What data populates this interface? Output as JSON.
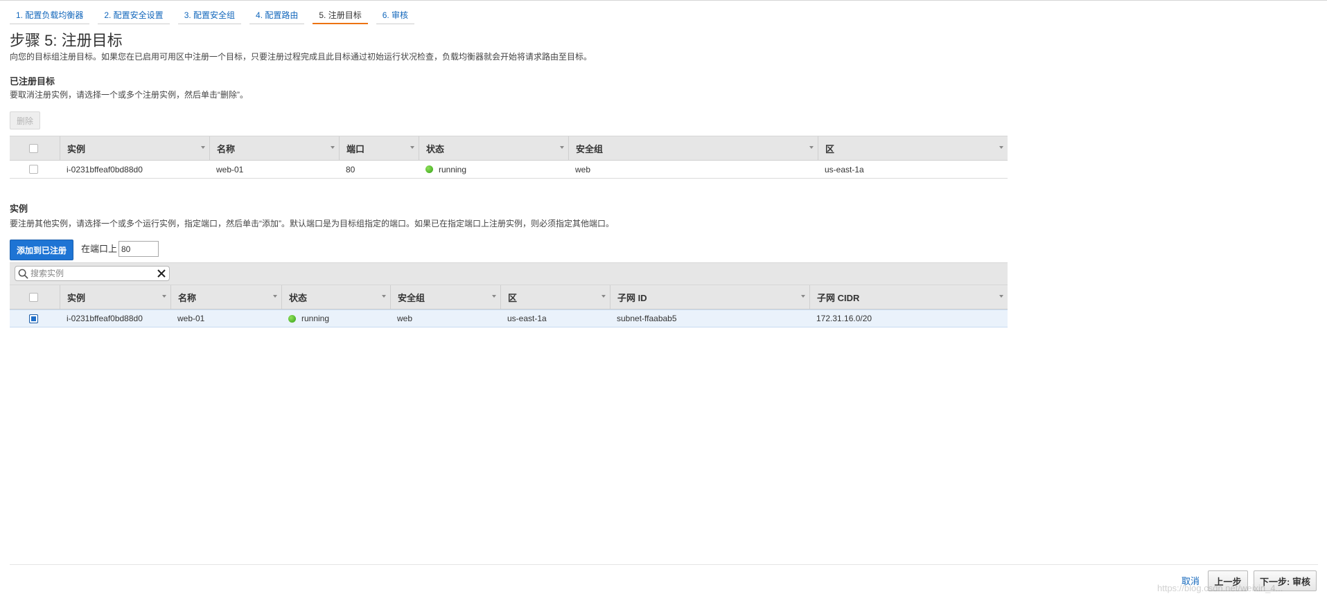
{
  "steps": [
    {
      "label": "1. 配置负载均衡器"
    },
    {
      "label": "2. 配置安全设置"
    },
    {
      "label": "3. 配置安全组"
    },
    {
      "label": "4. 配置路由"
    },
    {
      "label": "5. 注册目标"
    },
    {
      "label": "6. 审核"
    }
  ],
  "active_step": 5,
  "page": {
    "title": "步骤 5: 注册目标",
    "description": "向您的目标组注册目标。如果您在已启用可用区中注册一个目标，只要注册过程完成且此目标通过初始运行状况检查，负载均衡器就会开始将请求路由至目标。"
  },
  "registered": {
    "title": "已注册目标",
    "description": "要取消注册实例，请选择一个或多个注册实例，然后单击“删除”。",
    "remove_label": "删除",
    "columns": [
      "实例",
      "名称",
      "端口",
      "状态",
      "安全组",
      "区"
    ],
    "rows": [
      {
        "instance": "i-0231bffeaf0bd88d0",
        "name": "web-01",
        "port": "80",
        "status": "running",
        "sg": "web",
        "zone": "us-east-1a"
      }
    ]
  },
  "instances": {
    "title": "实例",
    "description": "要注册其他实例，请选择一个或多个运行实例，指定端口，然后单击“添加”。默认端口是为目标组指定的端口。如果已在指定端口上注册实例，则必须指定其他端口。",
    "add_label": "添加到已注册",
    "port_label": "在端口上",
    "port_value": "80",
    "search_placeholder": "搜索实例",
    "columns": [
      "实例",
      "名称",
      "状态",
      "安全组",
      "区",
      "子网 ID",
      "子网 CIDR"
    ],
    "rows": [
      {
        "instance": "i-0231bffeaf0bd88d0",
        "name": "web-01",
        "status": "running",
        "sg": "web",
        "zone": "us-east-1a",
        "subnet": "subnet-ffaabab5",
        "cidr": "172.31.16.0/20",
        "selected": true
      }
    ]
  },
  "footer": {
    "cancel": "取消",
    "prev": "上一步",
    "next": "下一步: 审核"
  },
  "watermark": "https://blog.csdn.net/weixin_4...",
  "colors": {
    "accent_orange": "#ec7211",
    "primary_blue": "#1e74d4",
    "link_blue": "#1166bb",
    "status_green": "#34a216"
  }
}
